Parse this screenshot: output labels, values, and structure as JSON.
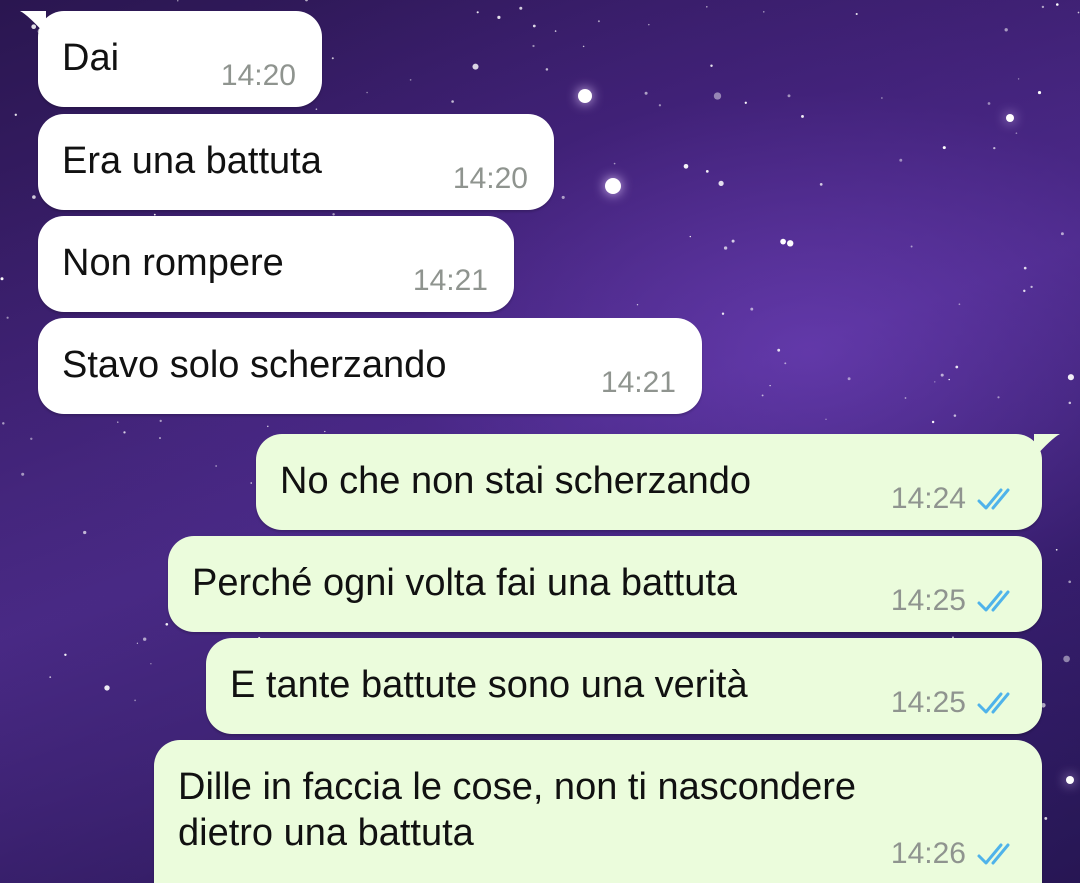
{
  "colors": {
    "incoming_bubble": "#ffffff",
    "outgoing_bubble": "#ebfcdc",
    "text": "#111111",
    "timestamp": "#8f948f",
    "read_ticks": "#4fb3ea"
  },
  "messages": [
    {
      "direction": "incoming",
      "text": "Dai",
      "time": "14:20"
    },
    {
      "direction": "incoming",
      "text": "Era una battuta",
      "time": "14:20"
    },
    {
      "direction": "incoming",
      "text": "Non rompere",
      "time": "14:21"
    },
    {
      "direction": "incoming",
      "text": "Stavo solo scherzando",
      "time": "14:21"
    },
    {
      "direction": "outgoing",
      "text": "No che non stai scherzando",
      "time": "14:24",
      "status_icon": "double-check-icon"
    },
    {
      "direction": "outgoing",
      "text": "Perché ogni volta fai una battuta",
      "time": "14:25",
      "status_icon": "double-check-icon"
    },
    {
      "direction": "outgoing",
      "text": "E tante battute sono una verità",
      "time": "14:25",
      "status_icon": "double-check-icon"
    },
    {
      "direction": "outgoing",
      "text": "Dille in faccia le cose, non ti nascondere\ndietro una battuta",
      "time": "14:26",
      "status_icon": "double-check-icon"
    }
  ]
}
